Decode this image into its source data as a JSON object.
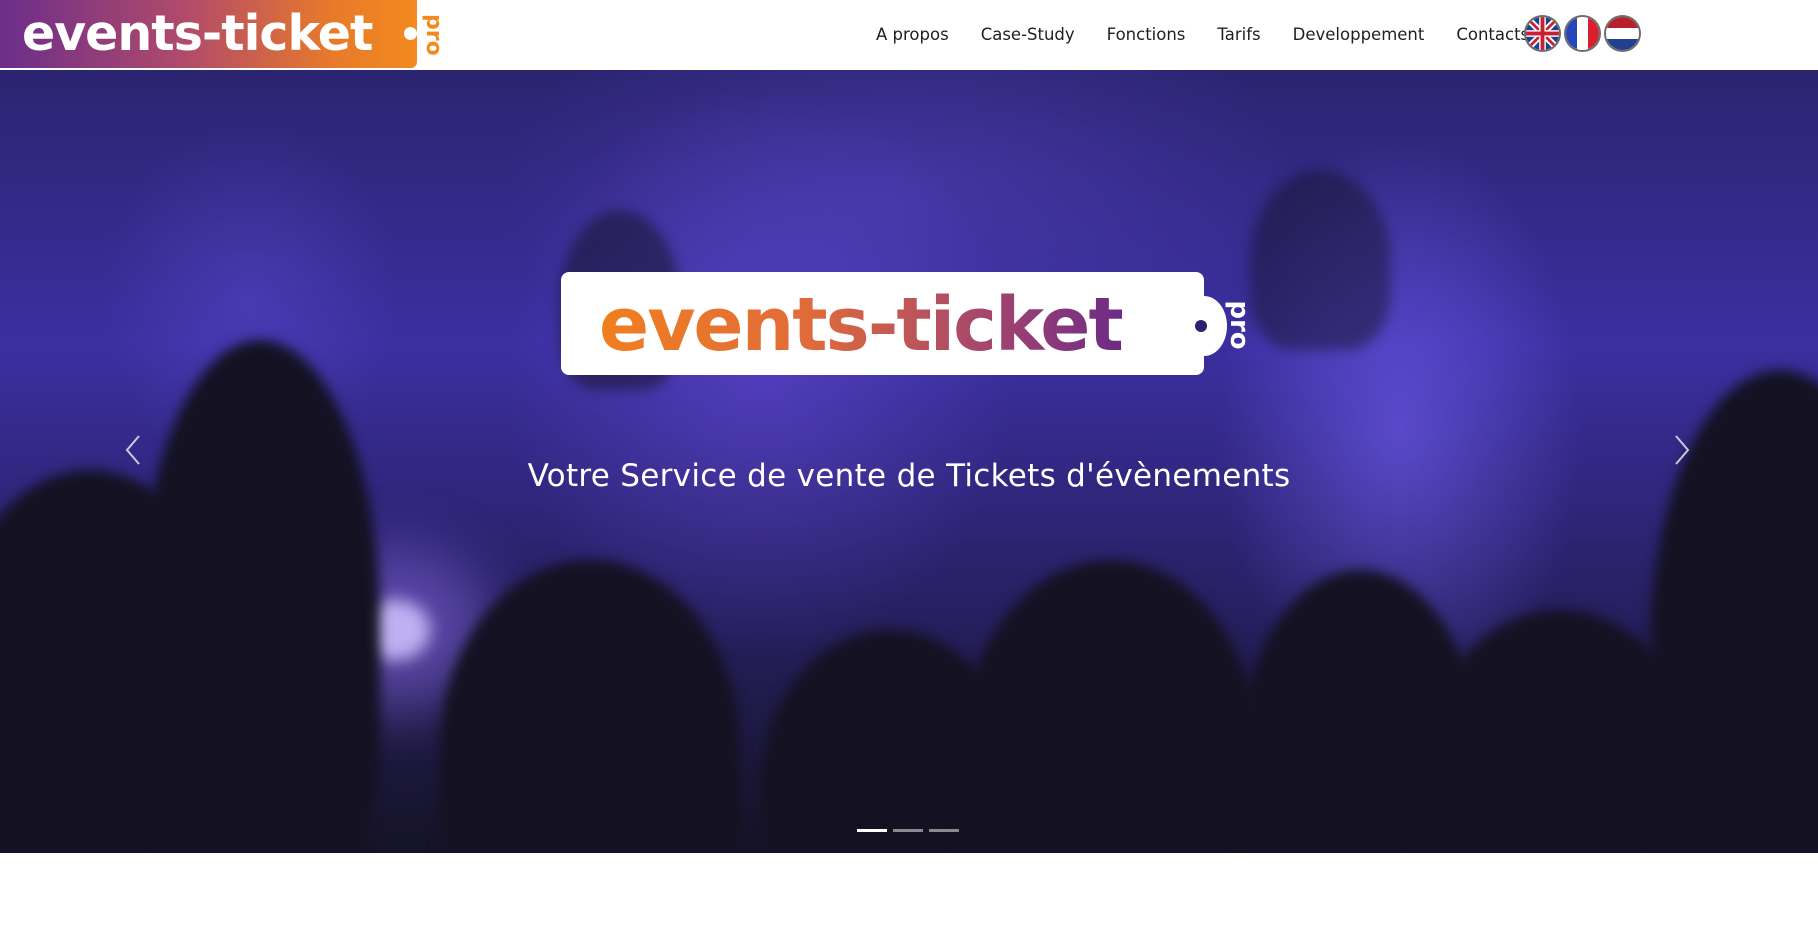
{
  "header": {
    "logo_text": "events-ticket",
    "logo_suffix": "pro",
    "nav": [
      {
        "label": "A propos"
      },
      {
        "label": "Case-Study"
      },
      {
        "label": "Fonctions"
      },
      {
        "label": "Tarifs"
      },
      {
        "label": "Developpement"
      },
      {
        "label": "Contacts"
      }
    ],
    "languages": [
      {
        "icon": "uk-flag-icon"
      },
      {
        "icon": "france-flag-icon"
      },
      {
        "icon": "netherlands-flag-icon"
      }
    ]
  },
  "hero": {
    "logo_text": "events-ticket",
    "logo_suffix": "pro",
    "tagline": "Votre Service de vente de Tickets d'évènements",
    "prev_icon": "chevron-left-icon",
    "next_icon": "chevron-right-icon",
    "slides_total": 3,
    "active_slide": 1
  },
  "colors": {
    "brand_orange": "#f28a1d",
    "brand_purple": "#6b2d8b",
    "hero_blue": "#3b2fa0"
  }
}
